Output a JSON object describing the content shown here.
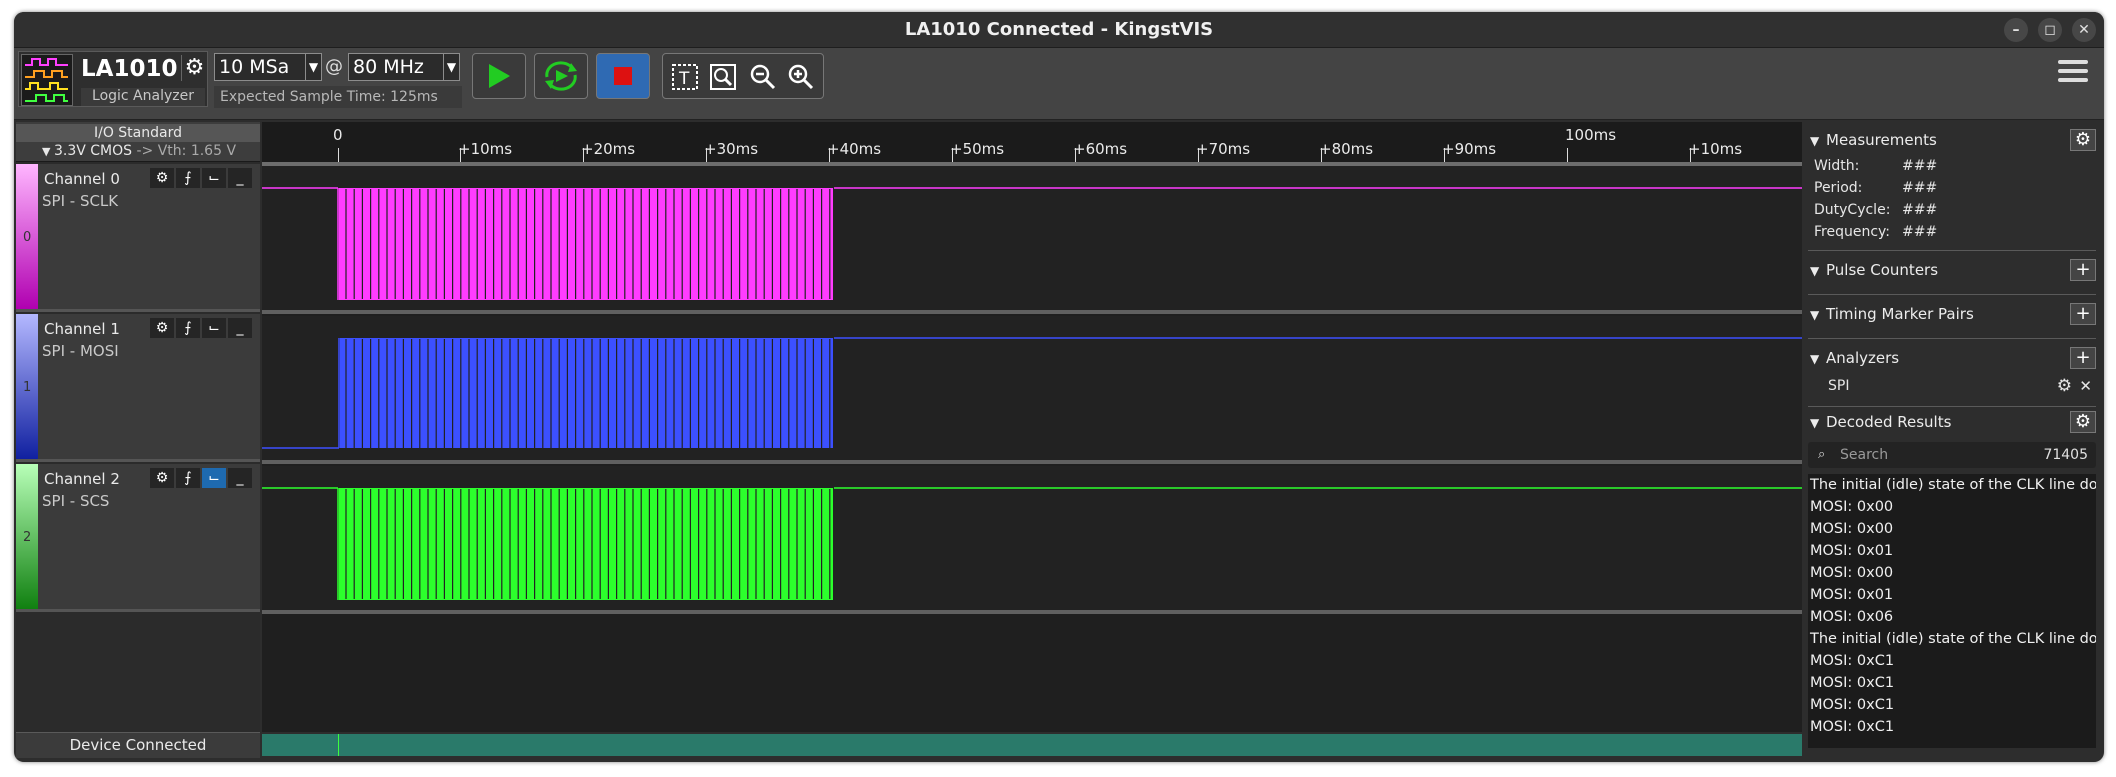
{
  "window": {
    "title": "LA1010 Connected - KingstVIS"
  },
  "device": {
    "name": "LA1010",
    "type": "Logic Analyzer"
  },
  "sample": {
    "depth": "10 MSa",
    "at": "@",
    "rate": "80 MHz",
    "expected": "Expected Sample Time: 125ms"
  },
  "io": {
    "title": "I/O Standard",
    "standard": "3.3V CMOS",
    "vth": "-> Vth: 1.65 V"
  },
  "ruler": {
    "labels": [
      "0",
      "+10ms",
      "+20ms",
      "+30ms",
      "+40ms",
      "+50ms",
      "+60ms",
      "+70ms",
      "+80ms",
      "+90ms",
      "100ms",
      "+10ms"
    ]
  },
  "channels": [
    {
      "name": "Channel 0",
      "label": "SPI - SCLK",
      "index": "0",
      "color": "#ff3cff"
    },
    {
      "name": "Channel 1",
      "label": "SPI - MOSI",
      "index": "1",
      "color": "#3c50ff"
    },
    {
      "name": "Channel 2",
      "label": "SPI - SCS",
      "index": "2",
      "color": "#2cff2c"
    }
  ],
  "status": {
    "device": "Device Connected"
  },
  "panel": {
    "measurements": {
      "title": "Measurements",
      "rows": [
        {
          "label": "Width:",
          "value": "###"
        },
        {
          "label": "Period:",
          "value": "###"
        },
        {
          "label": "DutyCycle:",
          "value": "###"
        },
        {
          "label": "Frequency:",
          "value": "###"
        }
      ]
    },
    "pulse_counters": "Pulse Counters",
    "timing_markers": "Timing Marker Pairs",
    "analyzers": {
      "title": "Analyzers",
      "items": [
        "SPI"
      ]
    },
    "decoded": {
      "title": "Decoded Results",
      "search_placeholder": "Search",
      "count": "71405",
      "rows": [
        "The initial (idle) state of the CLK line do...",
        "MOSI: 0x00",
        "MOSI: 0x00",
        "MOSI: 0x01",
        "MOSI: 0x00",
        "MOSI: 0x01",
        "MOSI: 0x06",
        "The initial (idle) state of the CLK line do...",
        "MOSI: 0xC1",
        "MOSI: 0xC1",
        "MOSI: 0xC1",
        "MOSI: 0xC1"
      ]
    }
  }
}
